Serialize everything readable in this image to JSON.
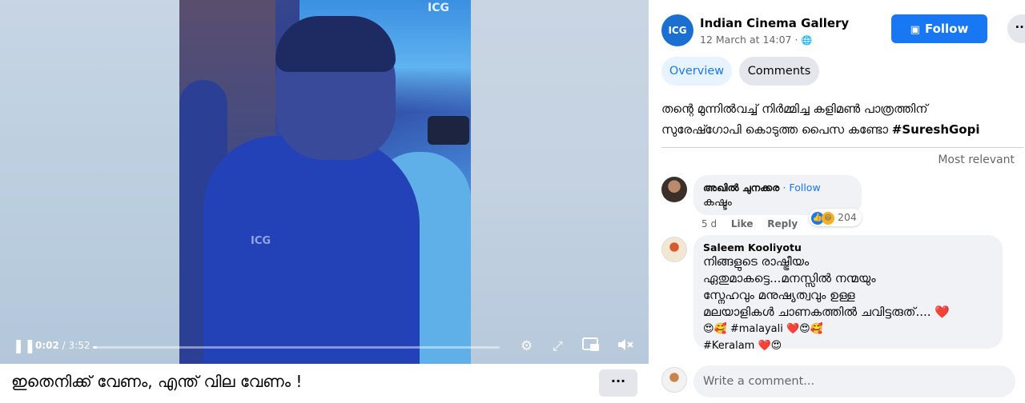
{
  "video": {
    "watermark": "ICG",
    "time_current": "0:02",
    "time_total": "3:52",
    "progress": 0.009,
    "caption": "ഇതെനിക്ക് വേണം, എന്ത് വില വേണം !",
    "more_label": "···"
  },
  "icons": {
    "play_pause": "pause-icon",
    "settings": "gear-icon",
    "fullscreen": "expand-icon",
    "pip": "picture-in-picture-icon",
    "volume": "mute-icon",
    "save": "bookmark-icon"
  },
  "post": {
    "page_logo_text": "ICG",
    "page_name": "Indian Cinema Gallery",
    "time": "12 March at 14:07 · ",
    "follow_label": "Follow",
    "tabs": [
      "Overview",
      "Comments"
    ],
    "text_line1": "തന്റെ മുന്നിൽവച്ച് നിർമ്മിച്ച കളിമൺ പാത്രത്തിന്",
    "text_line2": "സുരേഷ്ഗോപി കൊടുത്ത പൈസ കണ്ടോ ",
    "hashtag": "#SureshGopi",
    "sort_label": "Most relevant"
  },
  "comments": [
    {
      "author": "അഖിൽ ചുനക്കര",
      "follow": "· Follow",
      "text": "കഷ്ടം",
      "age": "5 d",
      "like_label": "Like",
      "reply_label": "Reply",
      "reactions": "204"
    },
    {
      "author": "Saleem Kooliyotu",
      "lines": [
        "നിങ്ങളുടെ രാഷ്ട്രീയം",
        "ഏതുമാകട്ടെ...മനസ്സിൽ നന്മയും",
        "സ്നേഹവും മനുഷ്യത്വവും ഉള്ള",
        "മലയാളികൾ ചാണകത്തിൽ ചവിട്ടരുത്.... ❤️",
        "😍🥰 #malayali ❤️😍🥰",
        "#Keralam ❤️😍"
      ]
    }
  ],
  "composer": {
    "placeholder": "Write a comment..."
  },
  "colors": {
    "accent": "#1877f2",
    "bubble": "#f0f2f5",
    "muted_text": "#65676b"
  }
}
